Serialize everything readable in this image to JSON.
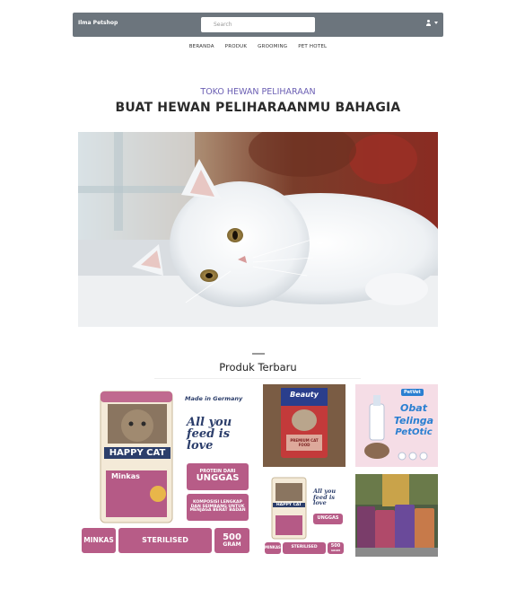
{
  "header": {
    "brand": "Ilma Petshop",
    "search_placeholder": "Search"
  },
  "nav": {
    "items": [
      "BERANDA",
      "PRODUK",
      "GROOMING",
      "PET HOTEL"
    ]
  },
  "hero": {
    "subtitle": "TOKO HEWAN PELIHARAAN",
    "headline": "BUAT HEWAN PELIHARAANMU BAHAGIA"
  },
  "products": {
    "section_title": "Produk Terbaru",
    "main": {
      "brand": "HAPPY CAT",
      "variant": "Minkas",
      "made_in": "Made in Germany",
      "slogan": "All you feed is love",
      "protein_label": "PROTEIN DARI",
      "protein_value": "UNGGAS",
      "composition": "KOMPOSISI LENGKAP DAN SEIMBANG UNTUK MENJAGA BERAT BADAN",
      "tag_minkas": "MINKAS",
      "tag_sterilised": "STERILISED",
      "weight_value": "500",
      "weight_unit": "GRAM"
    },
    "beauty": {
      "brand": "Beauty",
      "label": "PREMIUM CAT FOOD"
    },
    "petotic": {
      "brand": "PetVet",
      "line1": "Obat",
      "line2": "Telinga",
      "line3": "PetOtic"
    },
    "small_pack": {
      "brand": "HAPPY CAT",
      "slogan": "All you feed is love",
      "protein_value": "UNGGAS",
      "tag_minkas": "MINKAS",
      "tag_sterilised": "STERILISED",
      "weight_value": "500",
      "weight_unit": "GRAM"
    }
  },
  "colors": {
    "topbar": "#6c757d",
    "accent_purple": "#6b5fb3",
    "brand_pink": "#b75c87"
  }
}
